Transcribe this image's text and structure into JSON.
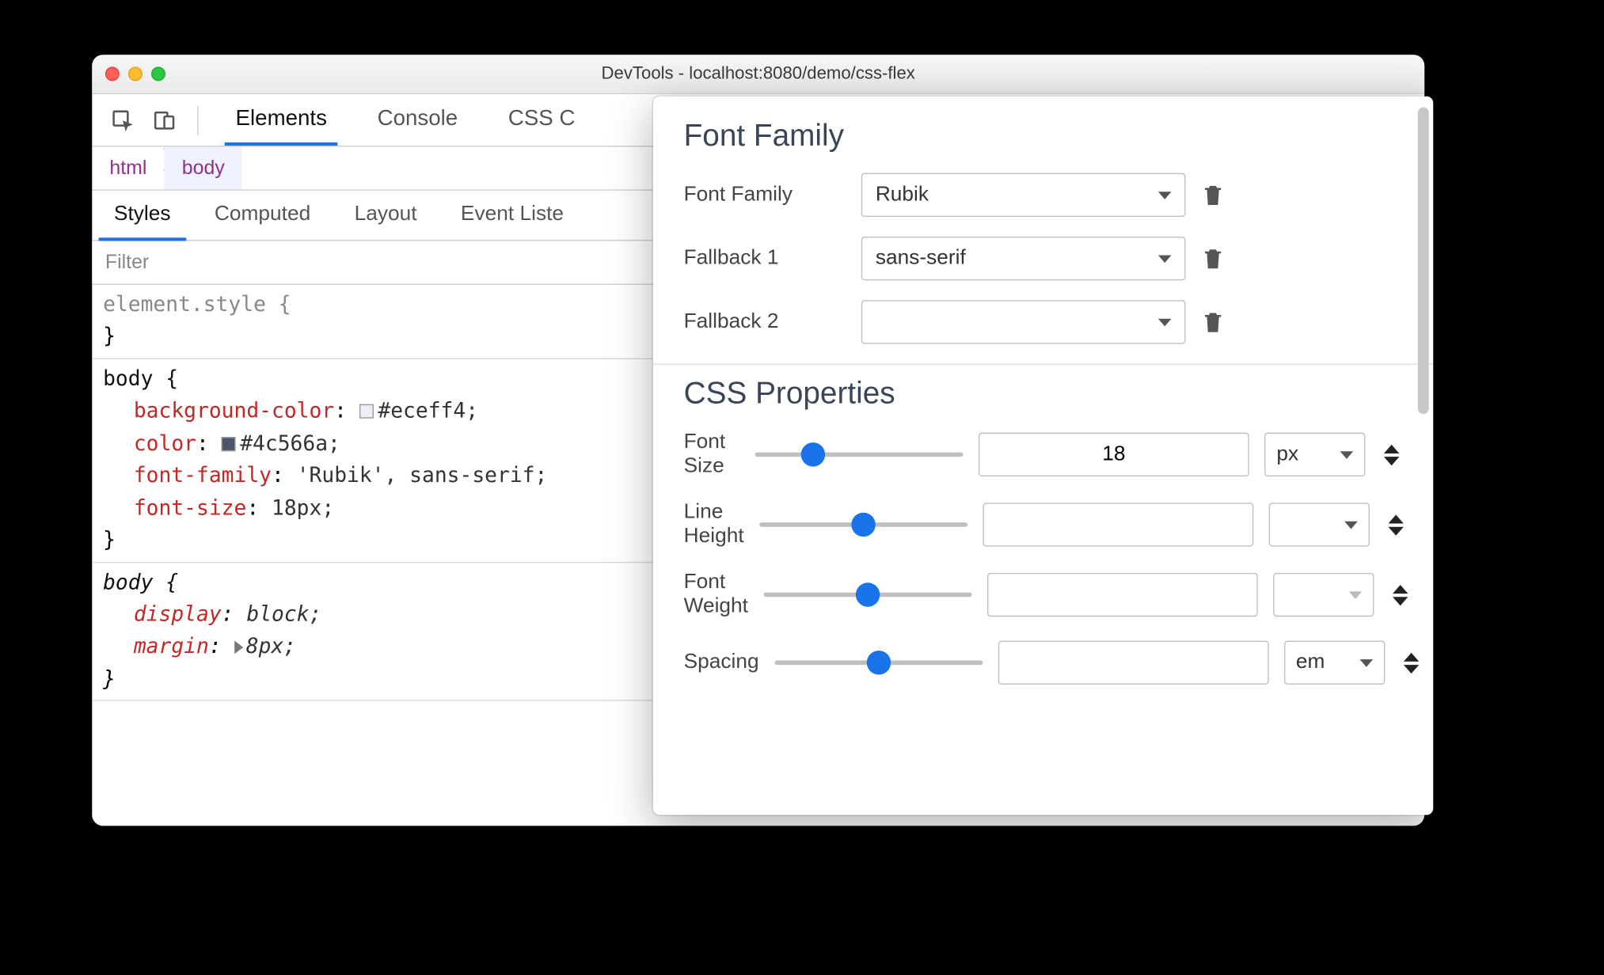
{
  "window": {
    "title": "DevTools - localhost:8080/demo/css-flex"
  },
  "tabs": {
    "elements": "Elements",
    "console": "Console",
    "css_partial": "CSS C"
  },
  "breadcrumb": [
    "html",
    "body"
  ],
  "subtabs": {
    "styles": "Styles",
    "computed": "Computed",
    "layout": "Layout",
    "event_partial": "Event Liste"
  },
  "filter_placeholder": "Filter",
  "rules": {
    "element_style": {
      "selector": "element.style {",
      "close": "}"
    },
    "body1": {
      "selector": "body {",
      "decls": [
        {
          "prop": "background-color",
          "swatch": "#eceff4",
          "val": "#eceff4;"
        },
        {
          "prop": "color",
          "swatch": "#4c566a",
          "val": "#4c566a;"
        },
        {
          "prop": "font-family",
          "val": "'Rubik', sans-serif;"
        },
        {
          "prop": "font-size",
          "val": "18px;"
        }
      ],
      "close": "}"
    },
    "body2": {
      "selector": "body {",
      "decls": [
        {
          "prop": "display",
          "val": "block;"
        },
        {
          "prop": "margin",
          "val": "8px;",
          "expand": true
        }
      ],
      "close": "}"
    }
  },
  "font_panel": {
    "section1_title": "Font Family",
    "rows": [
      {
        "label": "Font Family",
        "value": "Rubik"
      },
      {
        "label": "Fallback 1",
        "value": "sans-serif"
      },
      {
        "label": "Fallback 2",
        "value": ""
      }
    ],
    "section2_title": "CSS Properties",
    "props": [
      {
        "label": "Font Size",
        "value": "18",
        "unit": "px",
        "thumb": 28
      },
      {
        "label": "Line Height",
        "value": "",
        "unit": "",
        "thumb": 50
      },
      {
        "label": "Font Weight",
        "value": "",
        "unit": "",
        "thumb": 50,
        "unit_disabled": true
      },
      {
        "label": "Spacing",
        "value": "",
        "unit": "em",
        "thumb": 50
      }
    ]
  }
}
